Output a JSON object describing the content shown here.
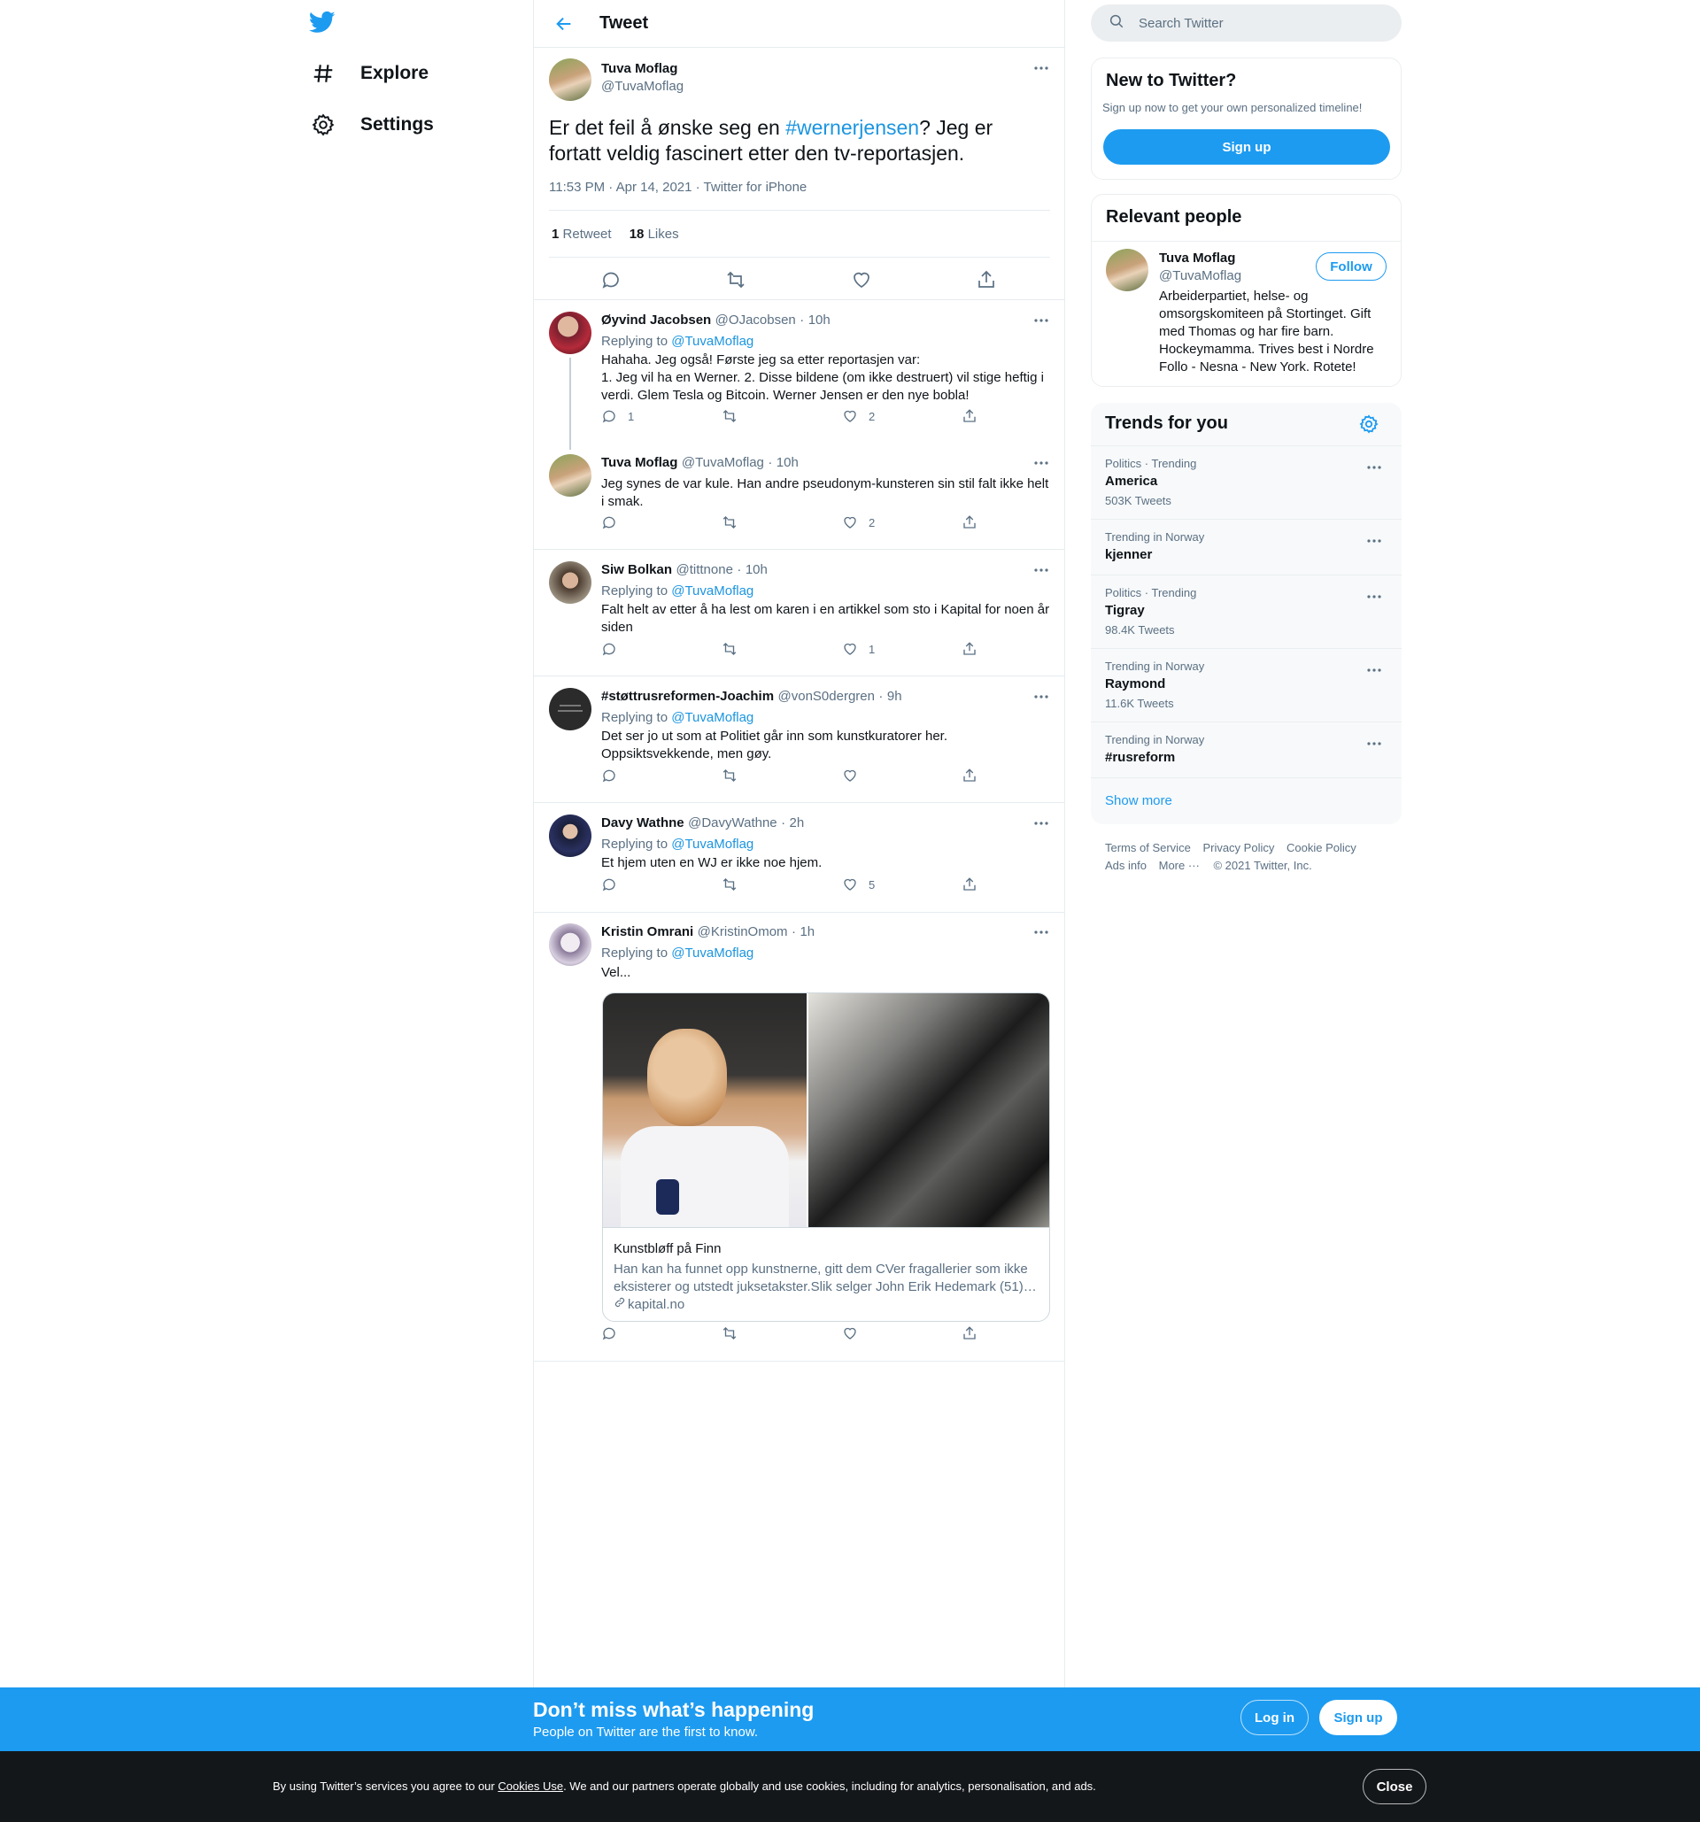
{
  "colors": {
    "accent": "#1d9bf0",
    "text": "#0f1419",
    "muted": "#5b7083",
    "border": "#e6ecf0",
    "cookie_bg": "#14171a"
  },
  "nav": {
    "logo": "twitter-bird-icon",
    "items": [
      {
        "label": "Explore",
        "icon": "hashtag-icon"
      },
      {
        "label": "Settings",
        "icon": "gear-icon"
      }
    ]
  },
  "header": {
    "title": "Tweet"
  },
  "main_tweet": {
    "name": "Tuva Moflag",
    "handle": "@TuvaMoflag",
    "text_before": "Er det feil å ønske seg en ",
    "hashtag": "#wernerjensen",
    "text_after": "? Jeg er fortatt veldig fascinert etter den tv-reportasjen.",
    "meta": "11:53 PM · Apr 14, 2021 · Twitter for iPhone",
    "retweets": {
      "count": "1",
      "label": "Retweet"
    },
    "likes": {
      "count": "18",
      "label": "Likes"
    }
  },
  "replying_label": "Replying to",
  "replies": [
    {
      "name": "Øyvind Jacobsen",
      "handle": "@OJacobsen",
      "time": "10h",
      "replying_to": "@TuvaMoflag",
      "text": "Hahaha. Jeg også! Første jeg sa etter reportasjen var:\n1. Jeg vil ha en Werner. 2. Disse bildene (om ikke destruert) vil stige heftig i verdi. Glem Tesla og Bitcoin. Werner Jensen er den nye bobla!",
      "reply_count": "1",
      "like_count": "2"
    },
    {
      "name": "Tuva Moflag",
      "handle": "@TuvaMoflag",
      "time": "10h",
      "text": "Jeg synes de var kule. Han andre pseudonym-kunsteren sin stil falt ikke helt i smak.",
      "reply_count": "",
      "like_count": "2"
    },
    {
      "name": "Siw Bolkan",
      "handle": "@tittnone",
      "time": "10h",
      "replying_to": "@TuvaMoflag",
      "text": "Falt helt av etter å ha lest om karen i en artikkel som sto i Kapital for noen år siden",
      "reply_count": "",
      "like_count": "1"
    },
    {
      "name": "#støttrusreformen-Joachim",
      "handle": "@vonS0dergren",
      "time": "9h",
      "replying_to": "@TuvaMoflag",
      "text": "Det ser jo ut som at Politiet går inn som kunstkuratorer her. Oppsiktsvekkende, men gøy.",
      "reply_count": "",
      "like_count": ""
    },
    {
      "name": "Davy Wathne",
      "handle": "@DavyWathne",
      "time": "2h",
      "replying_to": "@TuvaMoflag",
      "text": "Et hjem uten en WJ er ikke noe hjem.",
      "reply_count": "",
      "like_count": "5"
    },
    {
      "name": "Kristin Omrani",
      "handle": "@KristinOmom",
      "time": "1h",
      "replying_to": "@TuvaMoflag",
      "text": "Vel...",
      "reply_count": "",
      "like_count": "",
      "card": {
        "title": "Kunstbløff på Finn",
        "description": "Han kan ha funnet opp kunstnerne, gitt dem CVer fragallerier som ikke eksisterer og utstedt juksetakster.Slik selger John Erik Hedemark (51)…",
        "domain": "kapital.no"
      }
    }
  ],
  "sidebar": {
    "search_placeholder": "Search Twitter",
    "new_to_twitter": {
      "title": "New to Twitter?",
      "subtitle": "Sign up now to get your own personalized timeline!",
      "button": "Sign up"
    },
    "relevant_people": {
      "title": "Relevant people",
      "name": "Tuva Moflag",
      "handle": "@TuvaMoflag",
      "follow": "Follow",
      "bio": "Arbeiderpartiet, helse- og omsorgskomiteen på Stortinget. Gift med Thomas og har fire barn. Hockeymamma. Trives best i Nordre Follo - Nesna - New York. Rotete!"
    },
    "trends": {
      "title": "Trends for you",
      "items": [
        {
          "context": "Politics · Trending",
          "name": "America",
          "count": "503K Tweets"
        },
        {
          "context": "Trending in Norway",
          "name": "kjenner",
          "count": ""
        },
        {
          "context": "Politics · Trending",
          "name": "Tigray",
          "count": "98.4K Tweets"
        },
        {
          "context": "Trending in Norway",
          "name": "Raymond",
          "count": "11.6K Tweets"
        },
        {
          "context": "Trending in Norway",
          "name": "#rusreform",
          "count": ""
        }
      ],
      "show_more": "Show more"
    },
    "footer": {
      "terms": "Terms of Service",
      "privacy": "Privacy Policy",
      "cookie": "Cookie Policy",
      "ads": "Ads info",
      "more": "More",
      "copyright": "© 2021 Twitter, Inc."
    }
  },
  "bottom_bar": {
    "title": "Don’t miss what’s happening",
    "subtitle": "People on Twitter are the first to know.",
    "login": "Log in",
    "signup": "Sign up"
  },
  "cookie_bar": {
    "text_before": "By using Twitter’s services you agree to our ",
    "link": "Cookies Use",
    "text_after": ". We and our partners operate globally and use cookies, including for analytics, personalisation, and ads.",
    "close": "Close"
  }
}
